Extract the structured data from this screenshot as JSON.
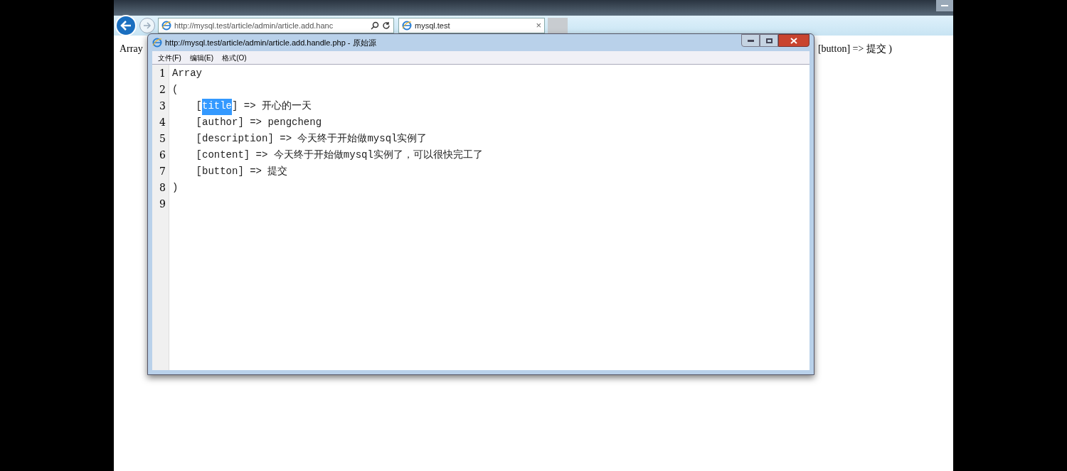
{
  "browser": {
    "address": "http://mysql.test/article/admin/article.add.hanc",
    "tab": {
      "title": "mysql.test",
      "close": "×"
    }
  },
  "page": {
    "left_text": "Array",
    "right_text": "[button] => 提交 )"
  },
  "source_window": {
    "title": "http://mysql.test/article/admin/article.add.handle.php - 原始源",
    "menu": [
      "文件(F)",
      "编辑(E)",
      "格式(O)"
    ],
    "lines": [
      {
        "number": "1",
        "segments": [
          {
            "text": "Array",
            "selected": false
          }
        ]
      },
      {
        "number": "2",
        "segments": [
          {
            "text": "(",
            "selected": false
          }
        ]
      },
      {
        "number": "3",
        "segments": [
          {
            "text": "    [",
            "selected": false
          },
          {
            "text": "title",
            "selected": true
          },
          {
            "text": "] => 开心的一天",
            "selected": false
          }
        ]
      },
      {
        "number": "4",
        "segments": [
          {
            "text": "    [author] => pengcheng",
            "selected": false
          }
        ]
      },
      {
        "number": "5",
        "segments": [
          {
            "text": "    [description] => 今天终于开始做mysql实例了",
            "selected": false
          }
        ]
      },
      {
        "number": "6",
        "segments": [
          {
            "text": "    [content] => 今天终于开始做mysql实例了，可以很快完工了",
            "selected": false
          }
        ]
      },
      {
        "number": "7",
        "segments": [
          {
            "text": "    [button] => 提交",
            "selected": false
          }
        ]
      },
      {
        "number": "8",
        "segments": [
          {
            "text": ")",
            "selected": false
          }
        ]
      },
      {
        "number": "9"
      }
    ]
  }
}
